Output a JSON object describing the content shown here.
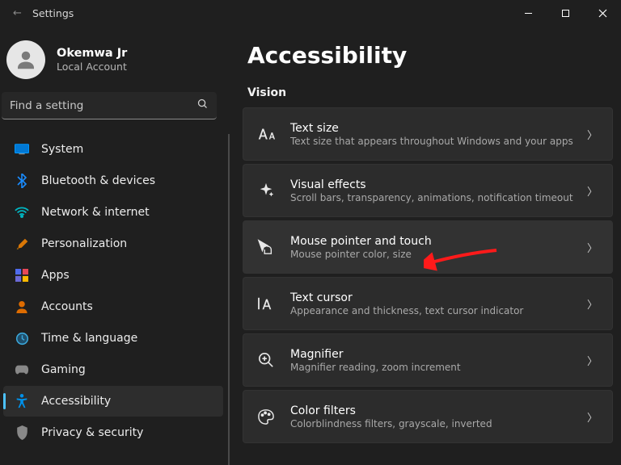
{
  "title": "Settings",
  "user": {
    "name": "Okemwa Jr",
    "sub": "Local Account"
  },
  "search": {
    "placeholder": "Find a setting"
  },
  "nav": {
    "items": [
      {
        "label": "System"
      },
      {
        "label": "Bluetooth & devices"
      },
      {
        "label": "Network & internet"
      },
      {
        "label": "Personalization"
      },
      {
        "label": "Apps"
      },
      {
        "label": "Accounts"
      },
      {
        "label": "Time & language"
      },
      {
        "label": "Gaming"
      },
      {
        "label": "Accessibility"
      },
      {
        "label": "Privacy & security"
      }
    ],
    "selected_index": 8
  },
  "page": {
    "title": "Accessibility",
    "section": "Vision",
    "cards": [
      {
        "title": "Text size",
        "sub": "Text size that appears throughout Windows and your apps"
      },
      {
        "title": "Visual effects",
        "sub": "Scroll bars, transparency, animations, notification timeout"
      },
      {
        "title": "Mouse pointer and touch",
        "sub": "Mouse pointer color, size"
      },
      {
        "title": "Text cursor",
        "sub": "Appearance and thickness, text cursor indicator"
      },
      {
        "title": "Magnifier",
        "sub": "Magnifier reading, zoom increment"
      },
      {
        "title": "Color filters",
        "sub": "Colorblindness filters, grayscale, inverted"
      }
    ],
    "hover_index": 2
  }
}
